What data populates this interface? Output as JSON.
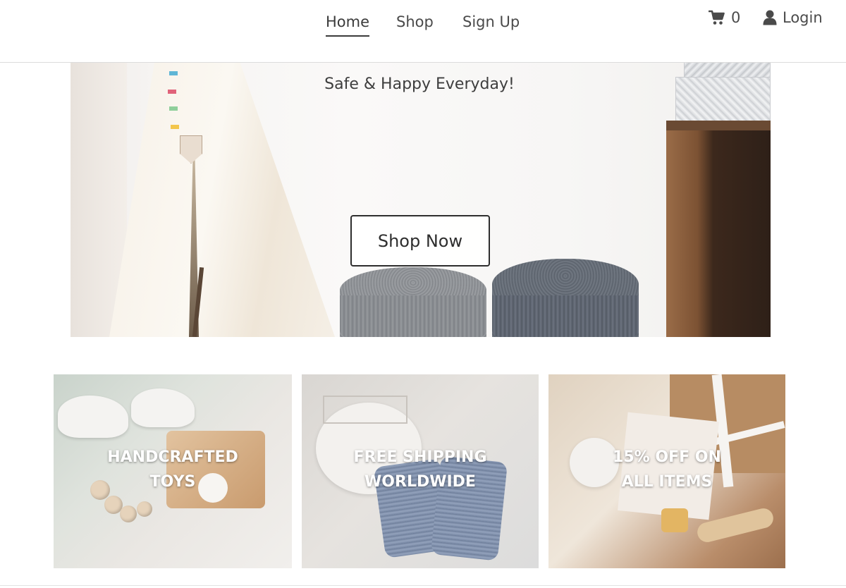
{
  "nav": {
    "home": "Home",
    "shop": "Shop",
    "signup": "Sign Up"
  },
  "cart": {
    "icon": "shopping-cart-icon",
    "count": "0"
  },
  "login": {
    "icon": "user-icon",
    "label": "Login"
  },
  "hero": {
    "tagline": "Safe & Happy Everyday!",
    "button_label": "Shop Now"
  },
  "features": [
    {
      "line1": "HANDCRAFTED",
      "line2": "TOYS"
    },
    {
      "line1": "FREE SHIPPING",
      "line2": "WORLDWIDE"
    },
    {
      "line1": "15% OFF ON",
      "line2": "ALL ITEMS"
    }
  ],
  "colors": {
    "text": "#3b3b3b",
    "button_border": "#2e2e2e",
    "header_border": "#dcdcdc"
  }
}
